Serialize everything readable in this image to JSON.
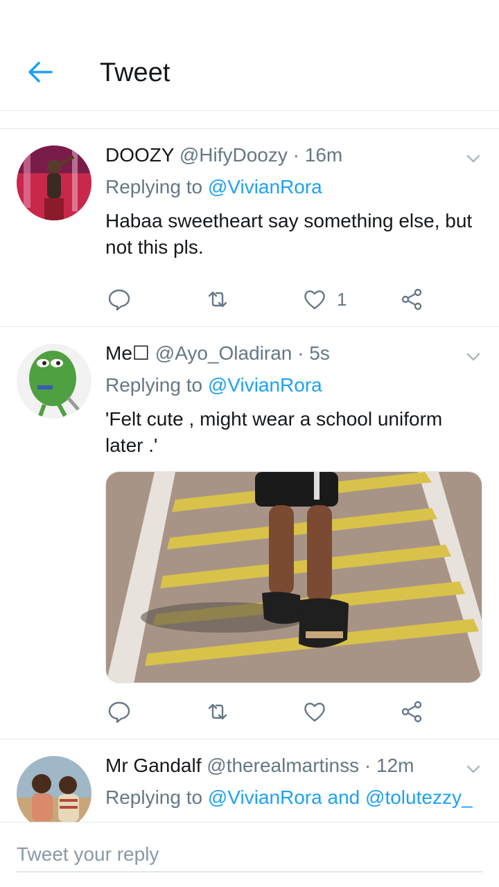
{
  "header": {
    "title": "Tweet",
    "back_icon": "arrow-left-icon",
    "accent": "#1da1f2"
  },
  "tweets": [
    {
      "name": "DOOZY",
      "handle": "@HifyDoozy",
      "separator": "·",
      "time": "16m",
      "replying_prefix": "Replying to",
      "replying_to": "@VivianRora",
      "text": "Habaa sweetheart say something else, but not this pls.",
      "likes": "1"
    },
    {
      "name": "Me☐",
      "handle": "@Ayo_Oladiran",
      "separator": "·",
      "time": "5s",
      "replying_prefix": "Replying to",
      "replying_to": "@VivianRora",
      "text": "'Felt cute , might wear a school uniform later .'"
    },
    {
      "name": "Mr Gandalf",
      "handle": "@therealmartinss",
      "separator": "·",
      "time": "12m",
      "replying_prefix": "Replying to",
      "replying_to": "@VivianRora and @tolutezzy_"
    }
  ],
  "reply_box": {
    "placeholder": "Tweet your reply"
  },
  "icons": {
    "reply": "reply-icon",
    "retweet": "retweet-icon",
    "like": "heart-icon",
    "share": "share-icon",
    "more": "chevron-down-icon"
  }
}
